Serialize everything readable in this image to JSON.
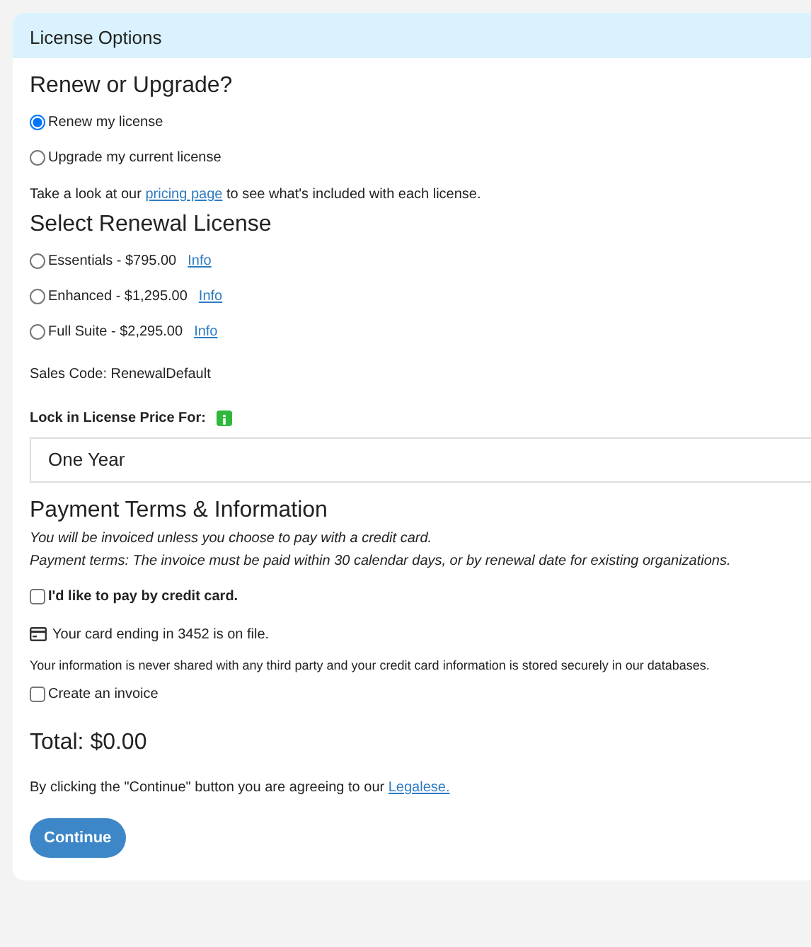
{
  "panel": {
    "title": "License Options"
  },
  "renew_section": {
    "heading": "Renew or Upgrade?",
    "options": [
      {
        "label": "Renew my license",
        "selected": true
      },
      {
        "label": "Upgrade my current license",
        "selected": false
      }
    ],
    "pricing_note": {
      "before": "Take a look at our ",
      "link": "pricing page",
      "after": " to see what's included with each license."
    }
  },
  "license_section": {
    "heading": "Select Renewal License",
    "options": [
      {
        "label": "Essentials - $795.00",
        "link": "Info",
        "selected": false
      },
      {
        "label": "Enhanced - $1,295.00",
        "link": "Info",
        "selected": false
      },
      {
        "label": "Full Suite - $2,295.00",
        "link": "Info",
        "selected": false
      }
    ],
    "sales_code": "Sales Code: RenewalDefault",
    "lock_label": "Lock in License Price For:",
    "lock_value": "One Year"
  },
  "payment_section": {
    "heading": "Payment Terms & Information",
    "notes": [
      "You will be invoiced unless you choose to pay with a credit card.",
      "Payment terms: The invoice must be paid within 30 calendar days, or by renewal date for existing organizations."
    ],
    "credit_card": {
      "label": "I'd like to pay by credit card.",
      "checked": false
    },
    "card_on_file": "Your card ending in 3452 is on file.",
    "privacy": "Your information is never shared with any third party and your credit card information is stored securely in our databases.",
    "invoice": {
      "label": "Create an invoice",
      "checked": false
    }
  },
  "total": "Total: $0.00",
  "agreement": {
    "before": "By clicking the \"Continue\" button you are agreeing to our ",
    "link": "Legalese."
  },
  "continue_button": "Continue"
}
